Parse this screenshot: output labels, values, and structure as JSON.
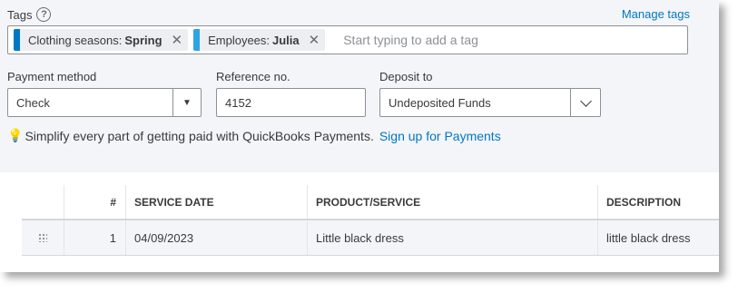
{
  "tags": {
    "label": "Tags",
    "help_icon": "?",
    "manage_label": "Manage tags",
    "chips": [
      {
        "group": "Clothing seasons:",
        "value": "Spring",
        "color": "#0077c5"
      },
      {
        "group": "Employees:",
        "value": "Julia",
        "color": "#2ca3e8"
      }
    ],
    "remove_icon": "✕",
    "placeholder": "Start typing to add a tag"
  },
  "payment_method": {
    "label": "Payment method",
    "value": "Check",
    "icon": "caret-down-icon",
    "arrow": "▼"
  },
  "reference_no": {
    "label": "Reference no.",
    "value": "4152"
  },
  "deposit_to": {
    "label": "Deposit to",
    "value": "Undeposited Funds",
    "icon": "chevron-down-icon"
  },
  "promo": {
    "icon": "lightbulb-icon",
    "bulb_glyph": "💡",
    "text": "Simplify every part of getting paid with QuickBooks Payments.",
    "link": "Sign up for Payments"
  },
  "table": {
    "columns": [
      "",
      "#",
      "SERVICE DATE",
      "PRODUCT/SERVICE",
      "DESCRIPTION"
    ],
    "rows": [
      {
        "num": "1",
        "service_date": "04/09/2023",
        "product": "Little black dress",
        "description": "little black dress"
      }
    ]
  }
}
